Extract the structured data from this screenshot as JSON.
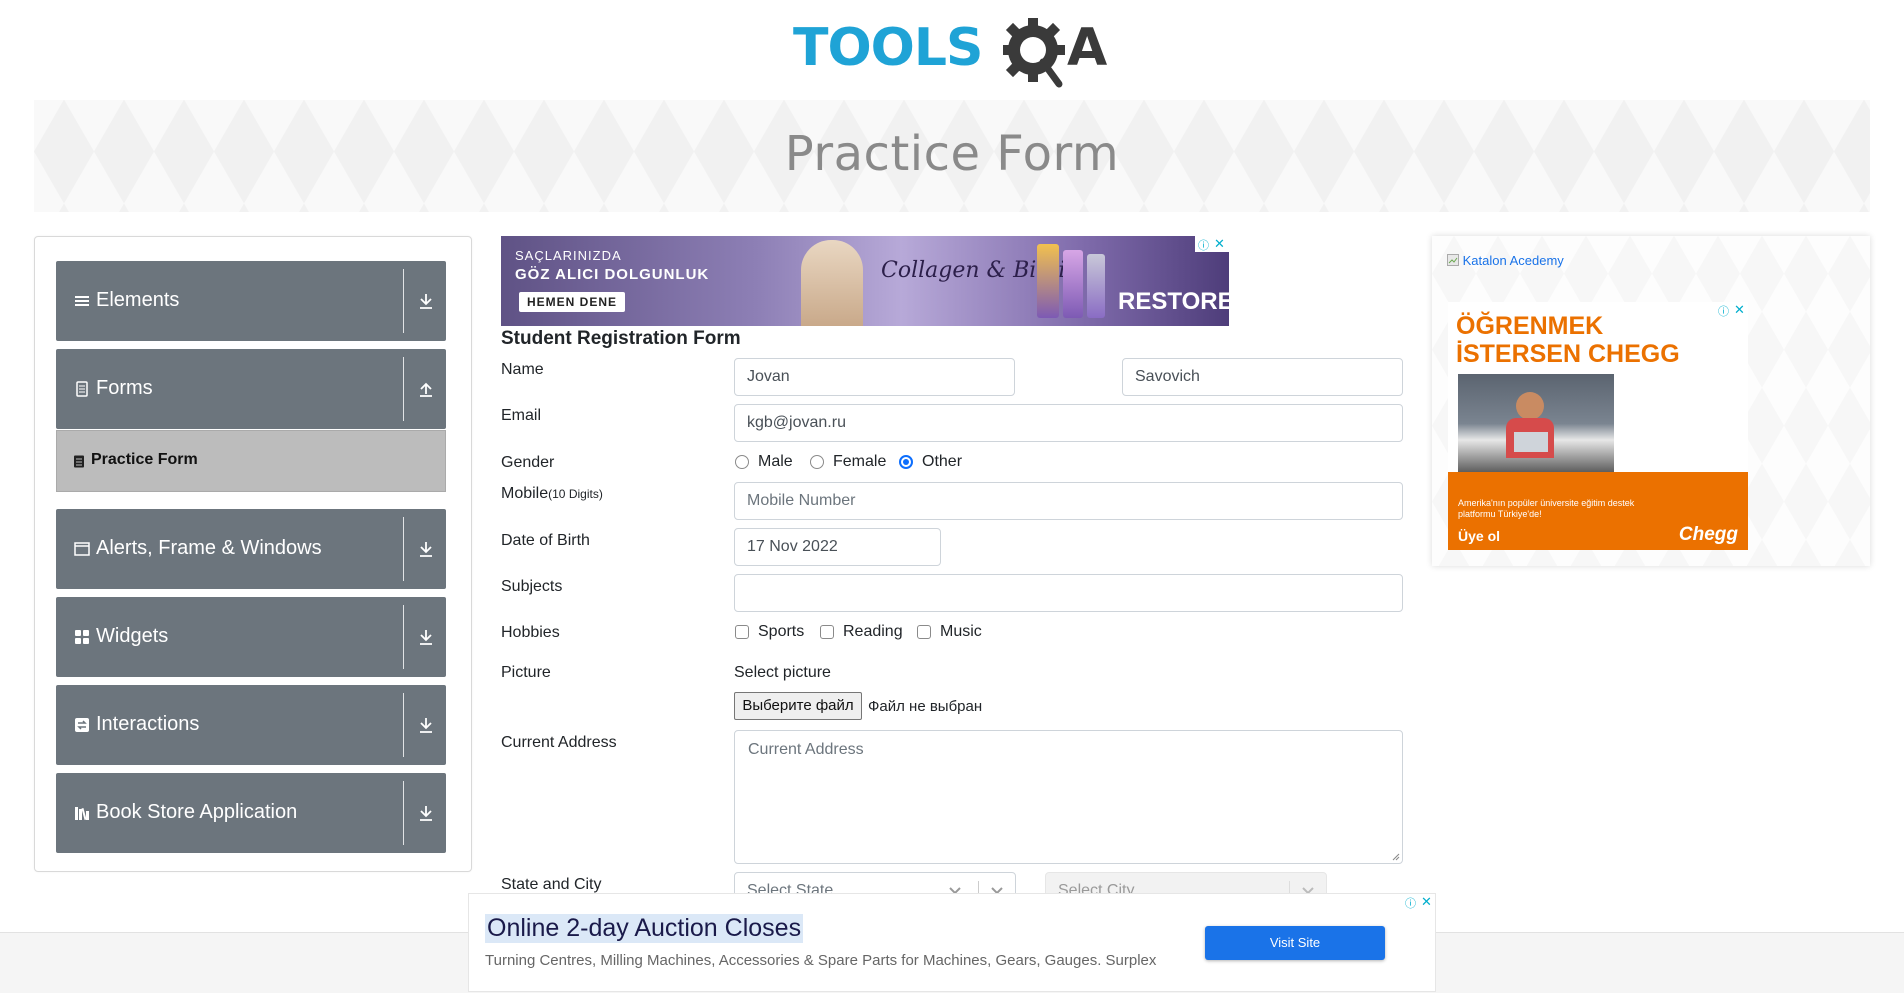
{
  "header": {
    "logo_tools": "TOOLS",
    "logo_qa": "QA"
  },
  "banner": {
    "title": "Practice Form"
  },
  "sidebar": {
    "groups": [
      {
        "label": "Elements",
        "icon": "menu-icon",
        "arrow": "download-icon"
      },
      {
        "label": "Forms",
        "icon": "document-icon",
        "arrow": "upload-icon"
      },
      {
        "label": "Alerts, Frame & Windows",
        "icon": "window-icon",
        "arrow": "download-icon"
      },
      {
        "label": "Widgets",
        "icon": "grid-icon",
        "arrow": "download-icon"
      },
      {
        "label": "Interactions",
        "icon": "interaction-icon",
        "arrow": "download-icon"
      },
      {
        "label": "Book Store Application",
        "icon": "books-icon",
        "arrow": "download-icon"
      }
    ],
    "active_item": {
      "label": "Practice Form",
      "icon": "document-icon"
    }
  },
  "ad_top": {
    "line1": "SAÇLARINIZDA",
    "line2": "GÖZ ALICI DOLGUNLUK",
    "cta": "HEMEN DENE",
    "script": "Collagen & Biotin",
    "brand": "RESTOREX"
  },
  "form": {
    "title": "Student Registration Form",
    "name_label": "Name",
    "first_name": "Jovan",
    "last_name": "Savovich",
    "email_label": "Email",
    "email": "kgb@jovan.ru",
    "gender_label": "Gender",
    "genders": [
      "Male",
      "Female",
      "Other"
    ],
    "gender_selected": "Other",
    "mobile_label": "Mobile",
    "mobile_hint": "(10 Digits)",
    "mobile_placeholder": "Mobile Number",
    "dob_label": "Date of Birth",
    "dob": "17 Nov 2022",
    "subjects_label": "Subjects",
    "hobbies_label": "Hobbies",
    "hobbies": [
      "Sports",
      "Reading",
      "Music"
    ],
    "picture_label": "Picture",
    "picture_caption": "Select picture",
    "file_button": "Выберите файл",
    "file_status": "Файл не выбран",
    "address_label": "Current Address",
    "address_placeholder": "Current Address",
    "state_city_label": "State and City",
    "state_placeholder": "Select State",
    "city_placeholder": "Select City"
  },
  "ad_right": {
    "broken_image_alt": "Katalon Acedemy",
    "headline_line1": "ÖĞRENMEK",
    "headline_line2": "İSTERSEN CHEGG",
    "body_line1": "Amerika'nın popüler üniversite eğitim destek",
    "body_line2": "platformu Türkiye'de!",
    "cta": "Üye ol",
    "brand": "Chegg"
  },
  "ad_bottom": {
    "title": "Online 2-day Auction Closes",
    "subtitle": "Turning Centres, Milling Machines, Accessories & Spare Parts for Machines, Gears, Gauges. Surplex",
    "button": "Visit Site"
  },
  "colors": {
    "sidebar_bg": "#6c757d",
    "active_item_bg": "#bcbcbc",
    "accent_blue": "#0d6efd",
    "logo_blue": "#1fa3d6",
    "chegg_orange": "#eb7100"
  }
}
